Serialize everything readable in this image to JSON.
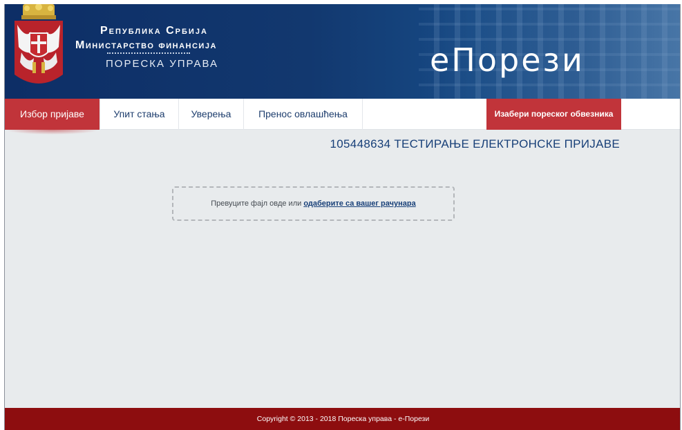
{
  "header": {
    "ministry_line1": "Република Србија",
    "ministry_line2": "Министарство финансија",
    "ministry_line3": "ПОРЕСКА УПРАВА",
    "brand": "еПорези",
    "crest_icon": "serbian-coat-of-arms-icon"
  },
  "nav": {
    "tabs": [
      {
        "label": "Избор пријаве",
        "active": true
      },
      {
        "label": "Упит стања",
        "active": false
      },
      {
        "label": "Уверења",
        "active": false
      },
      {
        "label": "Пренос овлашћења",
        "active": false
      }
    ],
    "taxpayer_button": "Изабери пореског обвезника"
  },
  "main": {
    "entity": "105448634 ТЕСТИРАЊЕ ЕЛЕКТРОНСКЕ ПРИЈАВЕ",
    "dropzone_text": "Превуците фајл овде или ",
    "dropzone_link": "одаберите са вашег рачунара"
  },
  "footer": {
    "copyright": "Copyright © 2013 - 2018 Пореска управа - е-Порези"
  },
  "colors": {
    "header_blue": "#12386f",
    "accent_red": "#c1343a",
    "footer_red": "#8d0d0f",
    "entity_blue": "#173f78"
  }
}
